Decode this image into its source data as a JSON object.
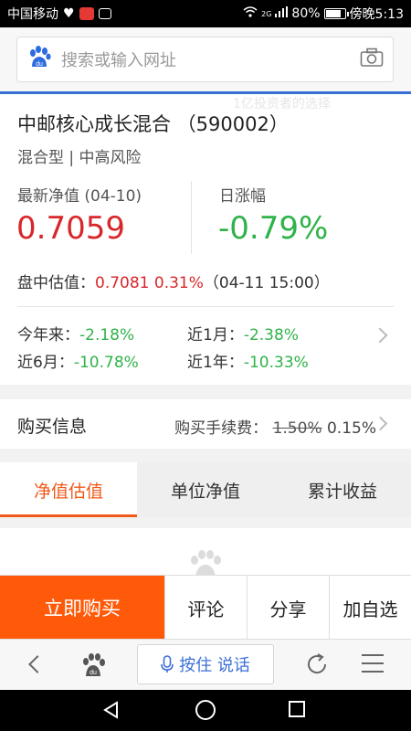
{
  "status_bar": {
    "carrier": "中国移动",
    "network": "2G",
    "battery": "80%",
    "battery_level": 0.8,
    "time": "傍晚5:13"
  },
  "search": {
    "placeholder": "搜索或输入网址"
  },
  "ghost_text": "1亿投资者的选择",
  "fund": {
    "name": "中邮核心成长混合 （590002）",
    "category": "混合型 | 中高风险",
    "nav_label": "最新净值 (04-10)",
    "nav_value": "0.7059",
    "change_label": "日涨幅",
    "change_value": "-0.79%",
    "intraday_label": "盘中估值：",
    "intraday_value": "0.7081 0.31%",
    "intraday_time": "（04-11 15:00）",
    "performance": [
      {
        "label": "今年来：",
        "value": "-2.18%"
      },
      {
        "label": "近1月：",
        "value": "-2.38%"
      },
      {
        "label": "近6月：",
        "value": "-10.78%"
      },
      {
        "label": "近1年：",
        "value": "-10.33%"
      }
    ]
  },
  "buy_info": {
    "title": "购买信息",
    "fee_label": "购买手续费：",
    "fee_old": "1.50%",
    "fee_new": "0.15%"
  },
  "tabs": [
    {
      "label": "净值估值",
      "active": true
    },
    {
      "label": "单位净值",
      "active": false
    },
    {
      "label": "累计收益",
      "active": false
    }
  ],
  "actions": {
    "buy_now": "立即购买",
    "comment": "评论",
    "share": "分享",
    "add_watch": "加自选"
  },
  "browser": {
    "voice_label": "按住 说话"
  },
  "colors": {
    "up_red": "#d8262a",
    "down_green": "#2fb34a",
    "accent_orange": "#ff5a0a",
    "link_blue": "#3b6fd8"
  },
  "icons": [
    "baidu-paw-icon",
    "camera-icon",
    "back-icon",
    "microphone-icon",
    "refresh-icon",
    "menu-icon",
    "chevron-right-icon"
  ]
}
